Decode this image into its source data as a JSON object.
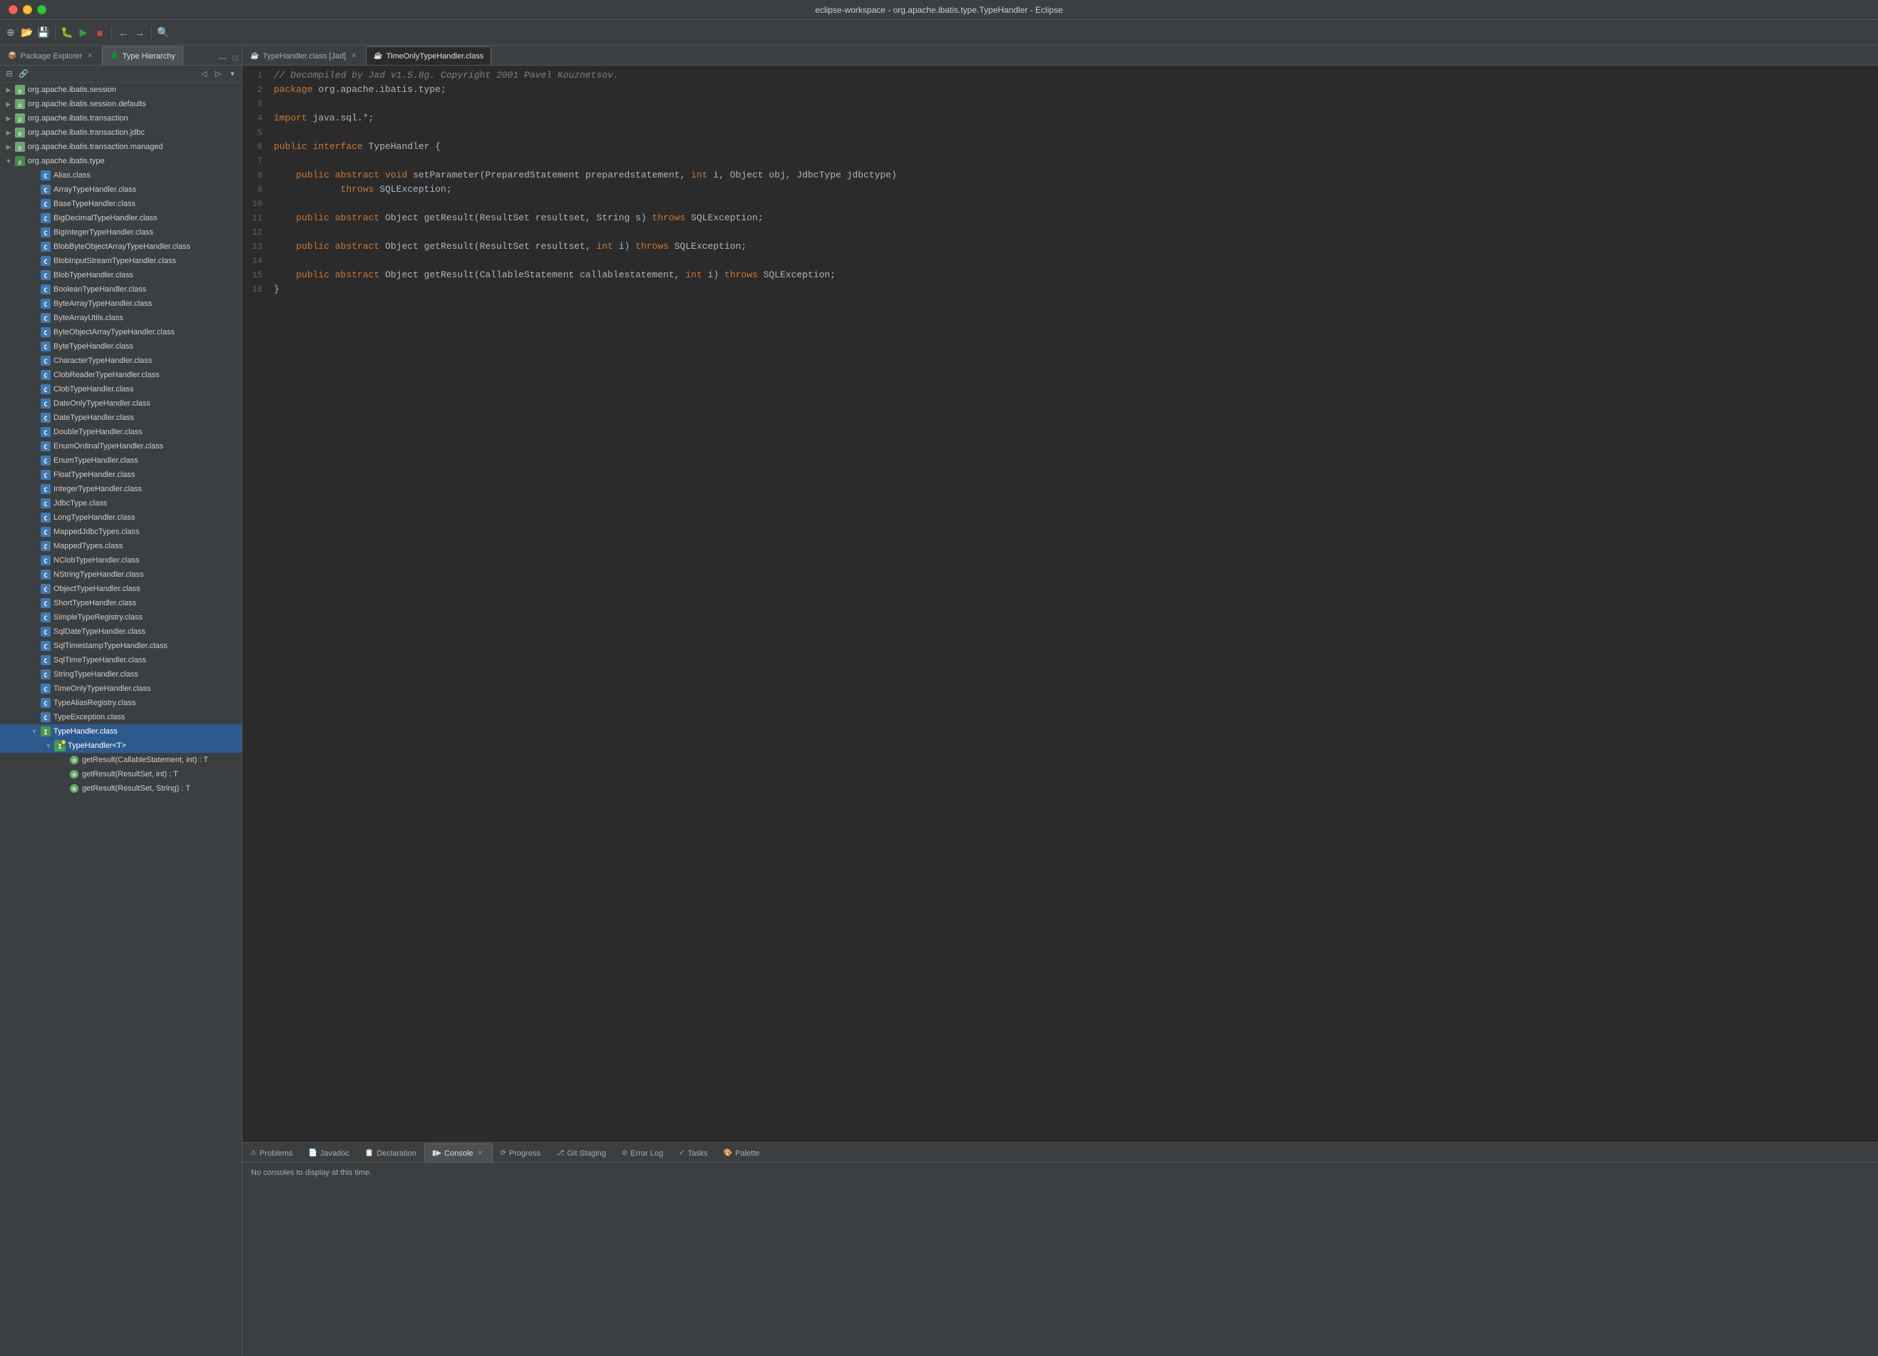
{
  "window": {
    "title": "eclipse-workspace - org.apache.ibatis.type.TypeHandler - Eclipse"
  },
  "toolbar": {
    "groups": []
  },
  "left_panel": {
    "tabs": [
      {
        "id": "package-explorer",
        "label": "Package Explorer",
        "active": false,
        "closeable": true
      },
      {
        "id": "type-hierarchy",
        "label": "Type Hierarchy",
        "active": true,
        "closeable": false
      }
    ],
    "toolbar_icons": [
      "collapse-all",
      "link-with-editor",
      "previous",
      "next",
      "view-menu"
    ]
  },
  "tree": {
    "items": [
      {
        "id": "pkg-session",
        "label": "org.apache.ibatis.session",
        "indent": 0,
        "type": "package",
        "expanded": false
      },
      {
        "id": "pkg-session-defaults",
        "label": "org.apache.ibatis.session.defaults",
        "indent": 0,
        "type": "package",
        "expanded": false
      },
      {
        "id": "pkg-transaction",
        "label": "org.apache.ibatis.transaction",
        "indent": 0,
        "type": "package",
        "expanded": false
      },
      {
        "id": "pkg-transaction-jdbc",
        "label": "org.apache.ibatis.transaction.jdbc",
        "indent": 0,
        "type": "package",
        "expanded": false
      },
      {
        "id": "pkg-transaction-managed",
        "label": "org.apache.ibatis.transaction.managed",
        "indent": 0,
        "type": "package",
        "expanded": false
      },
      {
        "id": "pkg-type",
        "label": "org.apache.ibatis.type",
        "indent": 0,
        "type": "package",
        "expanded": true
      },
      {
        "id": "cls-alias",
        "label": "Alias.class",
        "indent": 1,
        "type": "class"
      },
      {
        "id": "cls-arraytypehandler",
        "label": "ArrayTypeHandler.class",
        "indent": 1,
        "type": "class"
      },
      {
        "id": "cls-basetypehandler",
        "label": "BaseTypeHandler.class",
        "indent": 1,
        "type": "class"
      },
      {
        "id": "cls-bigdecimaltypehandler",
        "label": "BigDecimalTypeHandler.class",
        "indent": 1,
        "type": "class"
      },
      {
        "id": "cls-biginttypehandler",
        "label": "BigIntegerTypeHandler.class",
        "indent": 1,
        "type": "class"
      },
      {
        "id": "cls-blobbyteobjectarray",
        "label": "BlobByteObjectArrayTypeHandler.class",
        "indent": 1,
        "type": "class"
      },
      {
        "id": "cls-blobinputstream",
        "label": "BlobInputStreamTypeHandler.class",
        "indent": 1,
        "type": "class"
      },
      {
        "id": "cls-blobtypehandler",
        "label": "BlobTypeHandler.class",
        "indent": 1,
        "type": "class"
      },
      {
        "id": "cls-booleanhandler",
        "label": "BooleanTypeHandler.class",
        "indent": 1,
        "type": "class"
      },
      {
        "id": "cls-bytearraytypehandler",
        "label": "ByteArrayTypeHandler.class",
        "indent": 1,
        "type": "class"
      },
      {
        "id": "cls-bytearrayutils",
        "label": "ByteArrayUtils.class",
        "indent": 1,
        "type": "class"
      },
      {
        "id": "cls-byteobjectarray",
        "label": "ByteObjectArrayTypeHandler.class",
        "indent": 1,
        "type": "class"
      },
      {
        "id": "cls-bytehandler",
        "label": "ByteTypeHandler.class",
        "indent": 1,
        "type": "class"
      },
      {
        "id": "cls-charhandler",
        "label": "CharacterTypeHandler.class",
        "indent": 1,
        "type": "class"
      },
      {
        "id": "cls-clobreadertypehandler",
        "label": "ClobReaderTypeHandler.class",
        "indent": 1,
        "type": "class"
      },
      {
        "id": "cls-clobtypehandler",
        "label": "ClobTypeHandler.class",
        "indent": 1,
        "type": "class"
      },
      {
        "id": "cls-dateonlytypehandler",
        "label": "DateOnlyTypeHandler.class",
        "indent": 1,
        "type": "class"
      },
      {
        "id": "cls-datetypehandler",
        "label": "DateTypeHandler.class",
        "indent": 1,
        "type": "class"
      },
      {
        "id": "cls-doubletypehandler",
        "label": "DoubleTypeHandler.class",
        "indent": 1,
        "type": "class"
      },
      {
        "id": "cls-enumordinaltypehandler",
        "label": "EnumOrdinalTypeHandler.class",
        "indent": 1,
        "type": "class"
      },
      {
        "id": "cls-enumtypehandler",
        "label": "EnumTypeHandler.class",
        "indent": 1,
        "type": "class"
      },
      {
        "id": "cls-floattypehandler",
        "label": "FloatTypeHandler.class",
        "indent": 1,
        "type": "class"
      },
      {
        "id": "cls-integertypehandler",
        "label": "IntegerTypeHandler.class",
        "indent": 1,
        "type": "class"
      },
      {
        "id": "cls-jdbctype",
        "label": "JdbcType.class",
        "indent": 1,
        "type": "class"
      },
      {
        "id": "cls-longtypehandler",
        "label": "LongTypeHandler.class",
        "indent": 1,
        "type": "class"
      },
      {
        "id": "cls-mappedjdbctypes",
        "label": "MappedJdbcTypes.class",
        "indent": 1,
        "type": "class"
      },
      {
        "id": "cls-mappedtypes",
        "label": "MappedTypes.class",
        "indent": 1,
        "type": "class"
      },
      {
        "id": "cls-nclobtypehandler",
        "label": "NClobTypeHandler.class",
        "indent": 1,
        "type": "class"
      },
      {
        "id": "cls-nstringtypehandler",
        "label": "NStringTypeHandler.class",
        "indent": 1,
        "type": "class"
      },
      {
        "id": "cls-objecttypehandler",
        "label": "ObjectTypeHandler.class",
        "indent": 1,
        "type": "class"
      },
      {
        "id": "cls-shorttypehandler",
        "label": "ShortTypeHandler.class",
        "indent": 1,
        "type": "class"
      },
      {
        "id": "cls-simpletyperegistry",
        "label": "SimpleTypeRegistry.class",
        "indent": 1,
        "type": "class"
      },
      {
        "id": "cls-sqldatetypehandler",
        "label": "SqlDateTypeHandler.class",
        "indent": 1,
        "type": "class"
      },
      {
        "id": "cls-sqltimestamptypehandler",
        "label": "SqlTimestampTypeHandler.class",
        "indent": 1,
        "type": "class"
      },
      {
        "id": "cls-sqltimetypehandler",
        "label": "SqlTimeTypeHandler.class",
        "indent": 1,
        "type": "class"
      },
      {
        "id": "cls-stringtypehandler",
        "label": "StringTypeHandler.class",
        "indent": 1,
        "type": "class"
      },
      {
        "id": "cls-timeonlytypehandler",
        "label": "TimeOnlyTypeHandler.class",
        "indent": 1,
        "type": "class"
      },
      {
        "id": "cls-typealiasregistry",
        "label": "TypeAliasRegistry.class",
        "indent": 1,
        "type": "class"
      },
      {
        "id": "cls-typeexception",
        "label": "TypeException.class",
        "indent": 1,
        "type": "class"
      },
      {
        "id": "cls-typehandler",
        "label": "TypeHandler.class",
        "indent": 1,
        "type": "class",
        "selected": true,
        "expanded": true
      },
      {
        "id": "iface-typehandler",
        "label": "TypeHandler<T>",
        "indent": 2,
        "type": "interface",
        "expanded": false
      },
      {
        "id": "meth-getresult-callable",
        "label": "getResult(CallableStatement, int) : T",
        "indent": 3,
        "type": "method"
      },
      {
        "id": "meth-getresult-resultset-int",
        "label": "getResult(ResultSet, int) : T",
        "indent": 3,
        "type": "method"
      },
      {
        "id": "meth-getresult-resultset-string",
        "label": "getResult(ResultSet, String) : T",
        "indent": 3,
        "type": "method"
      }
    ]
  },
  "editor": {
    "tabs": [
      {
        "id": "typehandler-jad",
        "label": "TypeHandler.class [Jad]",
        "active": false,
        "closeable": true
      },
      {
        "id": "timeonlytypehandler",
        "label": "TimeOnlyTypeHandler.class",
        "active": true,
        "closeable": false
      }
    ],
    "filename": "TypeHandler.class [Jad]",
    "lines": [
      {
        "num": 1,
        "tokens": [
          {
            "cls": "cm",
            "text": "// Decompiled by Jad v1.5.8g. Copyright 2001 Pavel Kouznetsov."
          }
        ]
      },
      {
        "num": 2,
        "tokens": [
          {
            "cls": "kw",
            "text": "package"
          },
          {
            "cls": "plain",
            "text": " org.apache.ibatis.type;"
          }
        ]
      },
      {
        "num": 3,
        "tokens": []
      },
      {
        "num": 4,
        "tokens": [
          {
            "cls": "kw",
            "text": "import"
          },
          {
            "cls": "plain",
            "text": " java.sql.*;"
          }
        ]
      },
      {
        "num": 5,
        "tokens": []
      },
      {
        "num": 6,
        "tokens": [
          {
            "cls": "kw",
            "text": "public"
          },
          {
            "cls": "plain",
            "text": " "
          },
          {
            "cls": "kw",
            "text": "interface"
          },
          {
            "cls": "plain",
            "text": " TypeHandler {"
          }
        ]
      },
      {
        "num": 7,
        "tokens": []
      },
      {
        "num": 8,
        "tokens": [
          {
            "cls": "plain",
            "text": "    "
          },
          {
            "cls": "kw",
            "text": "public"
          },
          {
            "cls": "plain",
            "text": " "
          },
          {
            "cls": "kw",
            "text": "abstract"
          },
          {
            "cls": "plain",
            "text": " "
          },
          {
            "cls": "kw",
            "text": "void"
          },
          {
            "cls": "plain",
            "text": " setParameter(PreparedStatement preparedstatement, "
          },
          {
            "cls": "kw",
            "text": "int"
          },
          {
            "cls": "plain",
            "text": " i, Object obj, JdbcType jdbctype)"
          }
        ]
      },
      {
        "num": 9,
        "tokens": [
          {
            "cls": "plain",
            "text": "            "
          },
          {
            "cls": "kw",
            "text": "throws"
          },
          {
            "cls": "plain",
            "text": " SQLException;"
          }
        ]
      },
      {
        "num": 10,
        "tokens": []
      },
      {
        "num": 11,
        "tokens": [
          {
            "cls": "plain",
            "text": "    "
          },
          {
            "cls": "kw",
            "text": "public"
          },
          {
            "cls": "plain",
            "text": " "
          },
          {
            "cls": "kw",
            "text": "abstract"
          },
          {
            "cls": "plain",
            "text": " Object getResult(ResultSet resultset, String s) "
          },
          {
            "cls": "kw",
            "text": "throws"
          },
          {
            "cls": "plain",
            "text": " SQLException;"
          }
        ]
      },
      {
        "num": 12,
        "tokens": []
      },
      {
        "num": 13,
        "tokens": [
          {
            "cls": "plain",
            "text": "    "
          },
          {
            "cls": "kw",
            "text": "public"
          },
          {
            "cls": "plain",
            "text": " "
          },
          {
            "cls": "kw",
            "text": "abstract"
          },
          {
            "cls": "plain",
            "text": " Object getResult(ResultSet resultset, "
          },
          {
            "cls": "kw",
            "text": "int"
          },
          {
            "cls": "plain",
            "text": " i) "
          },
          {
            "cls": "kw",
            "text": "throws"
          },
          {
            "cls": "plain",
            "text": " SQLException;"
          }
        ]
      },
      {
        "num": 14,
        "tokens": []
      },
      {
        "num": 15,
        "tokens": [
          {
            "cls": "plain",
            "text": "    "
          },
          {
            "cls": "kw",
            "text": "public"
          },
          {
            "cls": "plain",
            "text": " "
          },
          {
            "cls": "kw",
            "text": "abstract"
          },
          {
            "cls": "plain",
            "text": " Object getResult(CallableStatement callablestatement, "
          },
          {
            "cls": "kw",
            "text": "int"
          },
          {
            "cls": "plain",
            "text": " i) "
          },
          {
            "cls": "kw",
            "text": "throws"
          },
          {
            "cls": "plain",
            "text": " SQLException;"
          }
        ]
      },
      {
        "num": 16,
        "tokens": [
          {
            "cls": "plain",
            "text": "}"
          }
        ]
      }
    ]
  },
  "bottom": {
    "tabs": [
      {
        "id": "problems",
        "label": "Problems",
        "active": false,
        "closeable": false
      },
      {
        "id": "javadoc",
        "label": "Javadoc",
        "active": false,
        "closeable": false
      },
      {
        "id": "declaration",
        "label": "Declaration",
        "active": false,
        "closeable": false
      },
      {
        "id": "console",
        "label": "Console",
        "active": true,
        "closeable": true
      },
      {
        "id": "progress",
        "label": "Progress",
        "active": false,
        "closeable": false
      },
      {
        "id": "git-staging",
        "label": "Git Staging",
        "active": false,
        "closeable": false
      },
      {
        "id": "error-log",
        "label": "Error Log",
        "active": false,
        "closeable": false
      },
      {
        "id": "tasks",
        "label": "Tasks",
        "active": false,
        "closeable": false
      },
      {
        "id": "palette",
        "label": "Palette",
        "active": false,
        "closeable": false
      }
    ],
    "console_message": "No consoles to display at this time."
  }
}
